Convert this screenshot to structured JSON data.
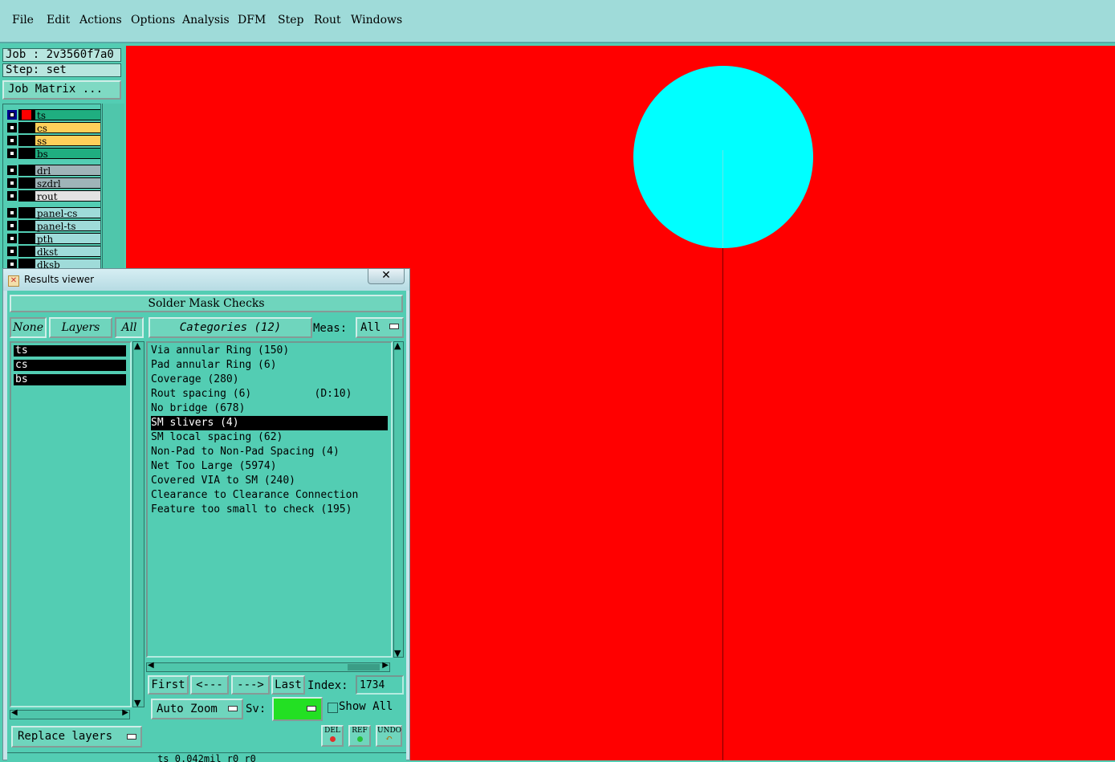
{
  "menu": [
    "File",
    "Edit",
    "Actions",
    "Options",
    "Analysis",
    "DFM",
    "Step",
    "Rout",
    "Windows"
  ],
  "job": {
    "job_label": "Job : 2v3560f7a0",
    "step_label": "Step: set",
    "matrix_button": "Job Matrix ..."
  },
  "layers": [
    {
      "name": "ts",
      "color": "#1fae80",
      "swatch": "#ff0000",
      "active": true
    },
    {
      "name": "cs",
      "color": "#ffcf5a"
    },
    {
      "name": "ss",
      "color": "#ffcf5a"
    },
    {
      "name": "bs",
      "color": "#1fae80"
    },
    {
      "name": "drl",
      "color": "#9fb4b8"
    },
    {
      "name": "szdrl",
      "color": "#9fb4b8"
    },
    {
      "name": "rout",
      "color": "#e3e3e3"
    },
    {
      "name": "panel-cs",
      "color": "#9fdbd9"
    },
    {
      "name": "panel-ts",
      "color": "#9fdbd9"
    },
    {
      "name": "pth",
      "color": "#9fdbd9"
    },
    {
      "name": "dkst",
      "color": "#9fdbd9"
    },
    {
      "name": "dksb",
      "color": "#9fdbd9"
    }
  ],
  "results_viewer": {
    "title": "Results viewer",
    "close": "✕",
    "header": "Solder Mask Checks",
    "none_btn": "None",
    "layers_btn": "Layers",
    "all_btn": "All",
    "categories_btn": "Categories (12)",
    "meas_label": "Meas:",
    "meas_value": "All",
    "selected_layers": [
      "ts",
      "cs",
      "bs"
    ],
    "categories": [
      {
        "label": "Via annular Ring (150)"
      },
      {
        "label": "Pad annular Ring (6)"
      },
      {
        "label": "Coverage (280)"
      },
      {
        "label": "Rout spacing (6)          (D:10)"
      },
      {
        "label": "No bridge (678)"
      },
      {
        "label": "SM slivers (4)",
        "selected": true
      },
      {
        "label": "SM local spacing (62)"
      },
      {
        "label": "Non-Pad to Non-Pad Spacing (4)"
      },
      {
        "label": "Net Too Large (5974)"
      },
      {
        "label": "Covered VIA to SM (240)"
      },
      {
        "label": "Clearance to Clearance Connection"
      },
      {
        "label": "Feature too small to check (195)"
      }
    ],
    "first_btn": "First",
    "prev_btn": "<---",
    "next_btn": "--->",
    "last_btn": "Last",
    "index_label": "Index:",
    "index_value": "1734",
    "zoom_value": "Auto Zoom",
    "sv_label": "Sv:",
    "show_all_label": "Show All",
    "replace_btn": "Replace layers",
    "del_btn": "DEL",
    "ref_btn": "REF",
    "undo_btn": "UNDO",
    "status": "ts 0.042mil  r0  r0"
  },
  "colors": {
    "canvas_bg": "#ff0000",
    "pad": "#00ffff",
    "ui_bg": "#53cdb3"
  }
}
